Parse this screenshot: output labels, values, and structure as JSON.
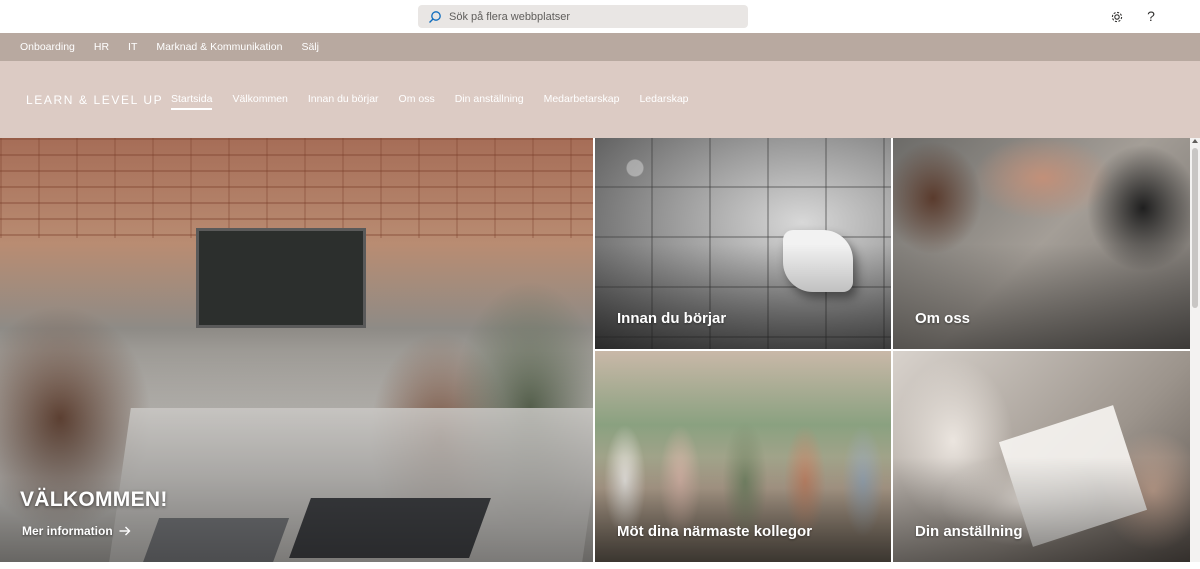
{
  "search": {
    "placeholder": "Sök på flera webbplatser"
  },
  "topbar": {
    "settings_icon": "gear-icon",
    "help_label": "?"
  },
  "hub_nav": {
    "items": [
      "Onboarding",
      "HR",
      "IT",
      "Marknad & Kommunikation",
      "Sälj"
    ]
  },
  "site": {
    "title": "LEARN & LEVEL UP",
    "nav": [
      "Startsida",
      "Välkommen",
      "Innan du börjar",
      "Om oss",
      "Din anställning",
      "Medarbetarskap",
      "Ledarskap"
    ],
    "active_nav": "Startsida"
  },
  "hero": {
    "main": {
      "title": "VÄLKOMMEN!",
      "link": "Mer information"
    },
    "tiles": [
      {
        "caption": "Innan du börjar"
      },
      {
        "caption": "Om oss"
      },
      {
        "caption": "Möt dina närmaste kollegor"
      },
      {
        "caption": "Din anställning"
      }
    ]
  },
  "colors": {
    "hub_nav_bg": "#b8a9a0",
    "site_header_bg": "#dccbc4",
    "search_bg": "#e9e6e4"
  }
}
